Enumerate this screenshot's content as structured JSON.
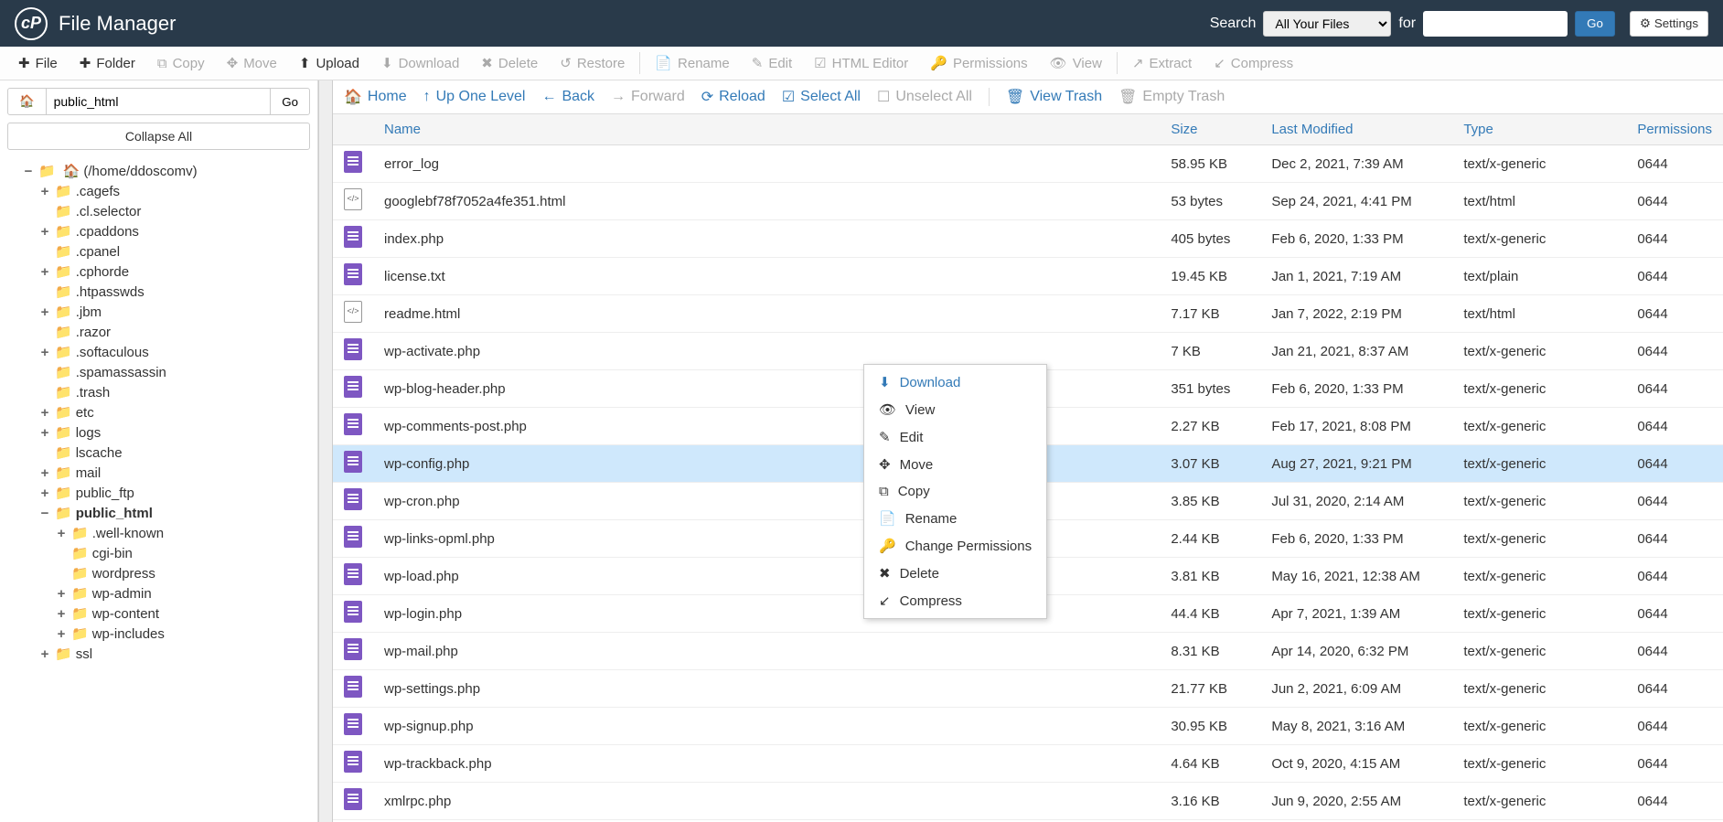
{
  "header": {
    "title": "File Manager",
    "search_label": "Search",
    "search_scope": "All Your Files",
    "for_label": "for",
    "search_value": "",
    "go": "Go",
    "settings": "Settings"
  },
  "toolbar": {
    "file": "File",
    "folder": "Folder",
    "copy": "Copy",
    "move": "Move",
    "upload": "Upload",
    "download": "Download",
    "delete": "Delete",
    "restore": "Restore",
    "rename": "Rename",
    "edit": "Edit",
    "html_editor": "HTML Editor",
    "permissions": "Permissions",
    "view": "View",
    "extract": "Extract",
    "compress": "Compress"
  },
  "sidebar": {
    "path": "public_html",
    "go": "Go",
    "collapse_all": "Collapse All",
    "root_label": "(/home/ddoscomv)",
    "tree": [
      {
        "label": ".cagefs",
        "indent": 2,
        "toggle": "+"
      },
      {
        "label": ".cl.selector",
        "indent": 2,
        "toggle": ""
      },
      {
        "label": ".cpaddons",
        "indent": 2,
        "toggle": "+"
      },
      {
        "label": ".cpanel",
        "indent": 2,
        "toggle": ""
      },
      {
        "label": ".cphorde",
        "indent": 2,
        "toggle": "+"
      },
      {
        "label": ".htpasswds",
        "indent": 2,
        "toggle": ""
      },
      {
        "label": ".jbm",
        "indent": 2,
        "toggle": "+"
      },
      {
        "label": ".razor",
        "indent": 2,
        "toggle": ""
      },
      {
        "label": ".softaculous",
        "indent": 2,
        "toggle": "+"
      },
      {
        "label": ".spamassassin",
        "indent": 2,
        "toggle": ""
      },
      {
        "label": ".trash",
        "indent": 2,
        "toggle": ""
      },
      {
        "label": "etc",
        "indent": 2,
        "toggle": "+"
      },
      {
        "label": "logs",
        "indent": 2,
        "toggle": "+"
      },
      {
        "label": "lscache",
        "indent": 2,
        "toggle": ""
      },
      {
        "label": "mail",
        "indent": 2,
        "toggle": "+"
      },
      {
        "label": "public_ftp",
        "indent": 2,
        "toggle": "+"
      },
      {
        "label": "public_html",
        "indent": 2,
        "toggle": "−",
        "bold": true
      },
      {
        "label": ".well-known",
        "indent": 3,
        "toggle": "+"
      },
      {
        "label": "cgi-bin",
        "indent": 3,
        "toggle": ""
      },
      {
        "label": "wordpress",
        "indent": 3,
        "toggle": ""
      },
      {
        "label": "wp-admin",
        "indent": 3,
        "toggle": "+"
      },
      {
        "label": "wp-content",
        "indent": 3,
        "toggle": "+"
      },
      {
        "label": "wp-includes",
        "indent": 3,
        "toggle": "+"
      },
      {
        "label": "ssl",
        "indent": 2,
        "toggle": "+"
      }
    ]
  },
  "nav": {
    "home": "Home",
    "up_one_level": "Up One Level",
    "back": "Back",
    "forward": "Forward",
    "reload": "Reload",
    "select_all": "Select All",
    "unselect_all": "Unselect All",
    "view_trash": "View Trash",
    "empty_trash": "Empty Trash"
  },
  "columns": {
    "name": "Name",
    "size": "Size",
    "last_modified": "Last Modified",
    "type": "Type",
    "permissions": "Permissions"
  },
  "files": [
    {
      "name": "error_log",
      "size": "58.95 KB",
      "modified": "Dec 2, 2021, 7:39 AM",
      "type": "text/x-generic",
      "perms": "0644",
      "icon": "generic"
    },
    {
      "name": "googlebf78f7052a4fe351.html",
      "size": "53 bytes",
      "modified": "Sep 24, 2021, 4:41 PM",
      "type": "text/html",
      "perms": "0644",
      "icon": "html"
    },
    {
      "name": "index.php",
      "size": "405 bytes",
      "modified": "Feb 6, 2020, 1:33 PM",
      "type": "text/x-generic",
      "perms": "0644",
      "icon": "generic"
    },
    {
      "name": "license.txt",
      "size": "19.45 KB",
      "modified": "Jan 1, 2021, 7:19 AM",
      "type": "text/plain",
      "perms": "0644",
      "icon": "generic"
    },
    {
      "name": "readme.html",
      "size": "7.17 KB",
      "modified": "Jan 7, 2022, 2:19 PM",
      "type": "text/html",
      "perms": "0644",
      "icon": "html"
    },
    {
      "name": "wp-activate.php",
      "size": "7 KB",
      "modified": "Jan 21, 2021, 8:37 AM",
      "type": "text/x-generic",
      "perms": "0644",
      "icon": "generic"
    },
    {
      "name": "wp-blog-header.php",
      "size": "351 bytes",
      "modified": "Feb 6, 2020, 1:33 PM",
      "type": "text/x-generic",
      "perms": "0644",
      "icon": "generic"
    },
    {
      "name": "wp-comments-post.php",
      "size": "2.27 KB",
      "modified": "Feb 17, 2021, 8:08 PM",
      "type": "text/x-generic",
      "perms": "0644",
      "icon": "generic"
    },
    {
      "name": "wp-config.php",
      "size": "3.07 KB",
      "modified": "Aug 27, 2021, 9:21 PM",
      "type": "text/x-generic",
      "perms": "0644",
      "icon": "generic",
      "selected": true
    },
    {
      "name": "wp-cron.php",
      "size": "3.85 KB",
      "modified": "Jul 31, 2020, 2:14 AM",
      "type": "text/x-generic",
      "perms": "0644",
      "icon": "generic"
    },
    {
      "name": "wp-links-opml.php",
      "size": "2.44 KB",
      "modified": "Feb 6, 2020, 1:33 PM",
      "type": "text/x-generic",
      "perms": "0644",
      "icon": "generic"
    },
    {
      "name": "wp-load.php",
      "size": "3.81 KB",
      "modified": "May 16, 2021, 12:38 AM",
      "type": "text/x-generic",
      "perms": "0644",
      "icon": "generic"
    },
    {
      "name": "wp-login.php",
      "size": "44.4 KB",
      "modified": "Apr 7, 2021, 1:39 AM",
      "type": "text/x-generic",
      "perms": "0644",
      "icon": "generic"
    },
    {
      "name": "wp-mail.php",
      "size": "8.31 KB",
      "modified": "Apr 14, 2020, 6:32 PM",
      "type": "text/x-generic",
      "perms": "0644",
      "icon": "generic"
    },
    {
      "name": "wp-settings.php",
      "size": "21.77 KB",
      "modified": "Jun 2, 2021, 6:09 AM",
      "type": "text/x-generic",
      "perms": "0644",
      "icon": "generic"
    },
    {
      "name": "wp-signup.php",
      "size": "30.95 KB",
      "modified": "May 8, 2021, 3:16 AM",
      "type": "text/x-generic",
      "perms": "0644",
      "icon": "generic"
    },
    {
      "name": "wp-trackback.php",
      "size": "4.64 KB",
      "modified": "Oct 9, 2020, 4:15 AM",
      "type": "text/x-generic",
      "perms": "0644",
      "icon": "generic"
    },
    {
      "name": "xmlrpc.php",
      "size": "3.16 KB",
      "modified": "Jun 9, 2020, 2:55 AM",
      "type": "text/x-generic",
      "perms": "0644",
      "icon": "generic"
    }
  ],
  "context_menu": {
    "download": "Download",
    "view": "View",
    "edit": "Edit",
    "move": "Move",
    "copy": "Copy",
    "rename": "Rename",
    "change_permissions": "Change Permissions",
    "delete": "Delete",
    "compress": "Compress"
  }
}
